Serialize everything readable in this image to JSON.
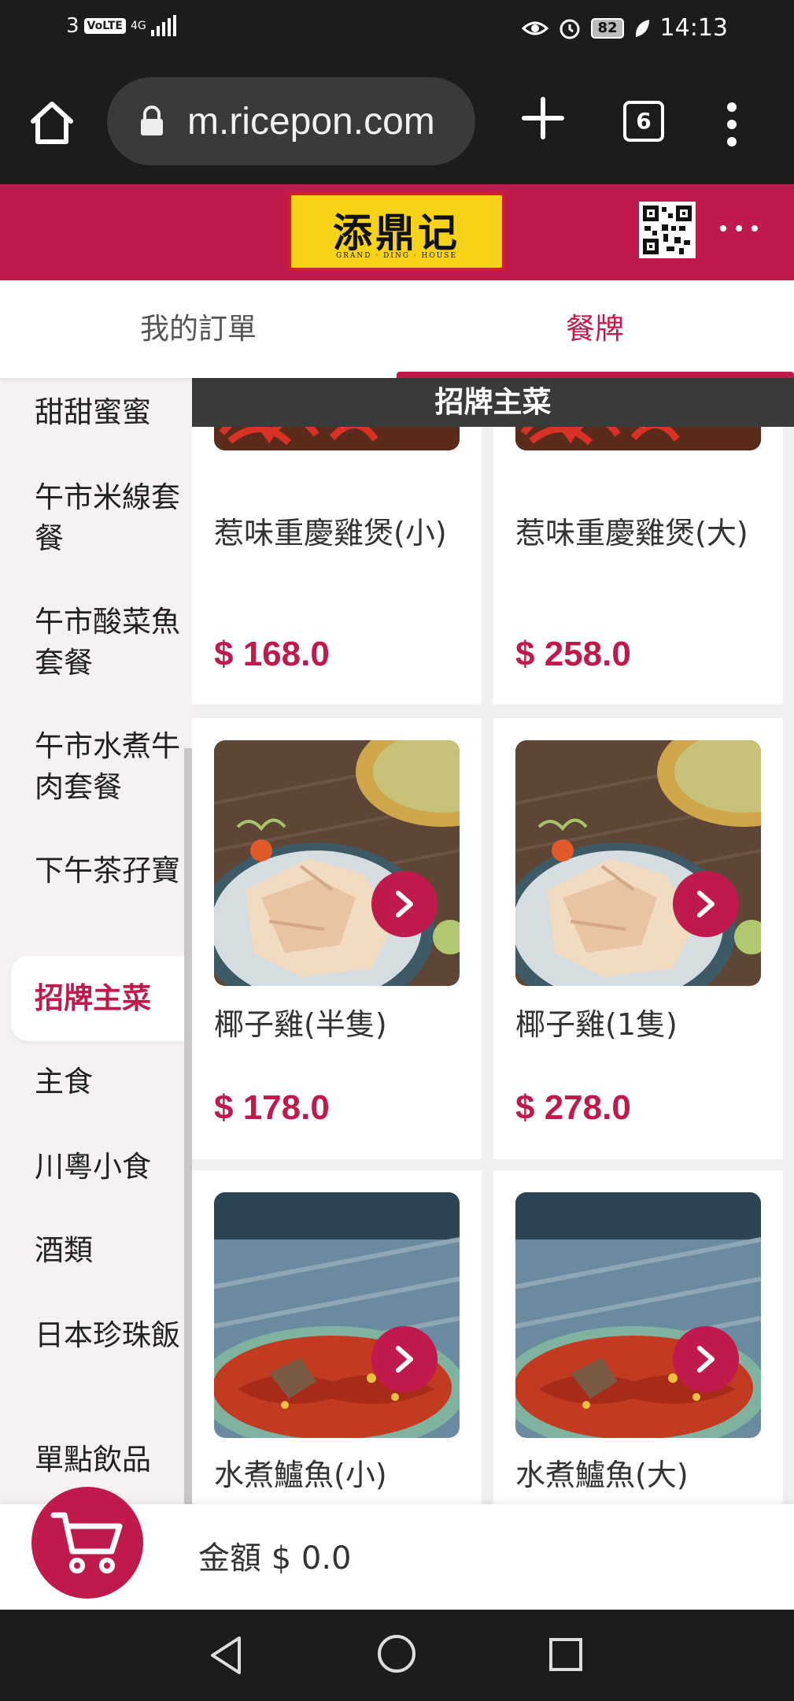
{
  "status_bar": {
    "carrier": "3",
    "volte": "VoLTE",
    "network": "4G",
    "battery": "82",
    "time": "14:13"
  },
  "browser": {
    "url": "m.ricepon.com",
    "tab_count": "6"
  },
  "header": {
    "logo_text": "添鼎记",
    "logo_subtext": "GRAND · DING · HOUSE",
    "brand_color": "#c0194b"
  },
  "tabs": [
    {
      "label": "我的訂單",
      "active": false
    },
    {
      "label": "餐牌",
      "active": true
    }
  ],
  "sidebar": {
    "items": [
      {
        "label": "甜甜蜜蜜"
      },
      {
        "label": "午市米線套餐"
      },
      {
        "label": "午市酸菜魚套餐"
      },
      {
        "label": "午市水煮牛肉套餐"
      },
      {
        "label": "下午茶孖寶"
      },
      {
        "label": "招牌主菜",
        "active": true
      },
      {
        "label": "主食"
      },
      {
        "label": "川粵小食"
      },
      {
        "label": "酒類"
      },
      {
        "label": "日本珍珠飯"
      },
      {
        "label": "單點飲品"
      }
    ]
  },
  "content": {
    "section_title": "招牌主菜",
    "items": [
      {
        "name": "惹味重慶雞煲(小)",
        "price": "$ 168.0",
        "image": "chicken-pot-dish"
      },
      {
        "name": "惹味重慶雞煲(大)",
        "price": "$ 258.0",
        "image": "chicken-pot-dish"
      },
      {
        "name": "椰子雞(半隻)",
        "price": "$ 178.0",
        "image": "coconut-chicken-dish"
      },
      {
        "name": "椰子雞(1隻)",
        "price": "$ 278.0",
        "image": "coconut-chicken-dish"
      },
      {
        "name": "水煮鱸魚(小)",
        "price": "",
        "image": "boiled-perch-dish"
      },
      {
        "name": "水煮鱸魚(大)",
        "price": "",
        "image": "boiled-perch-dish"
      }
    ]
  },
  "cart": {
    "total_label": "金額 $ 0.0"
  }
}
